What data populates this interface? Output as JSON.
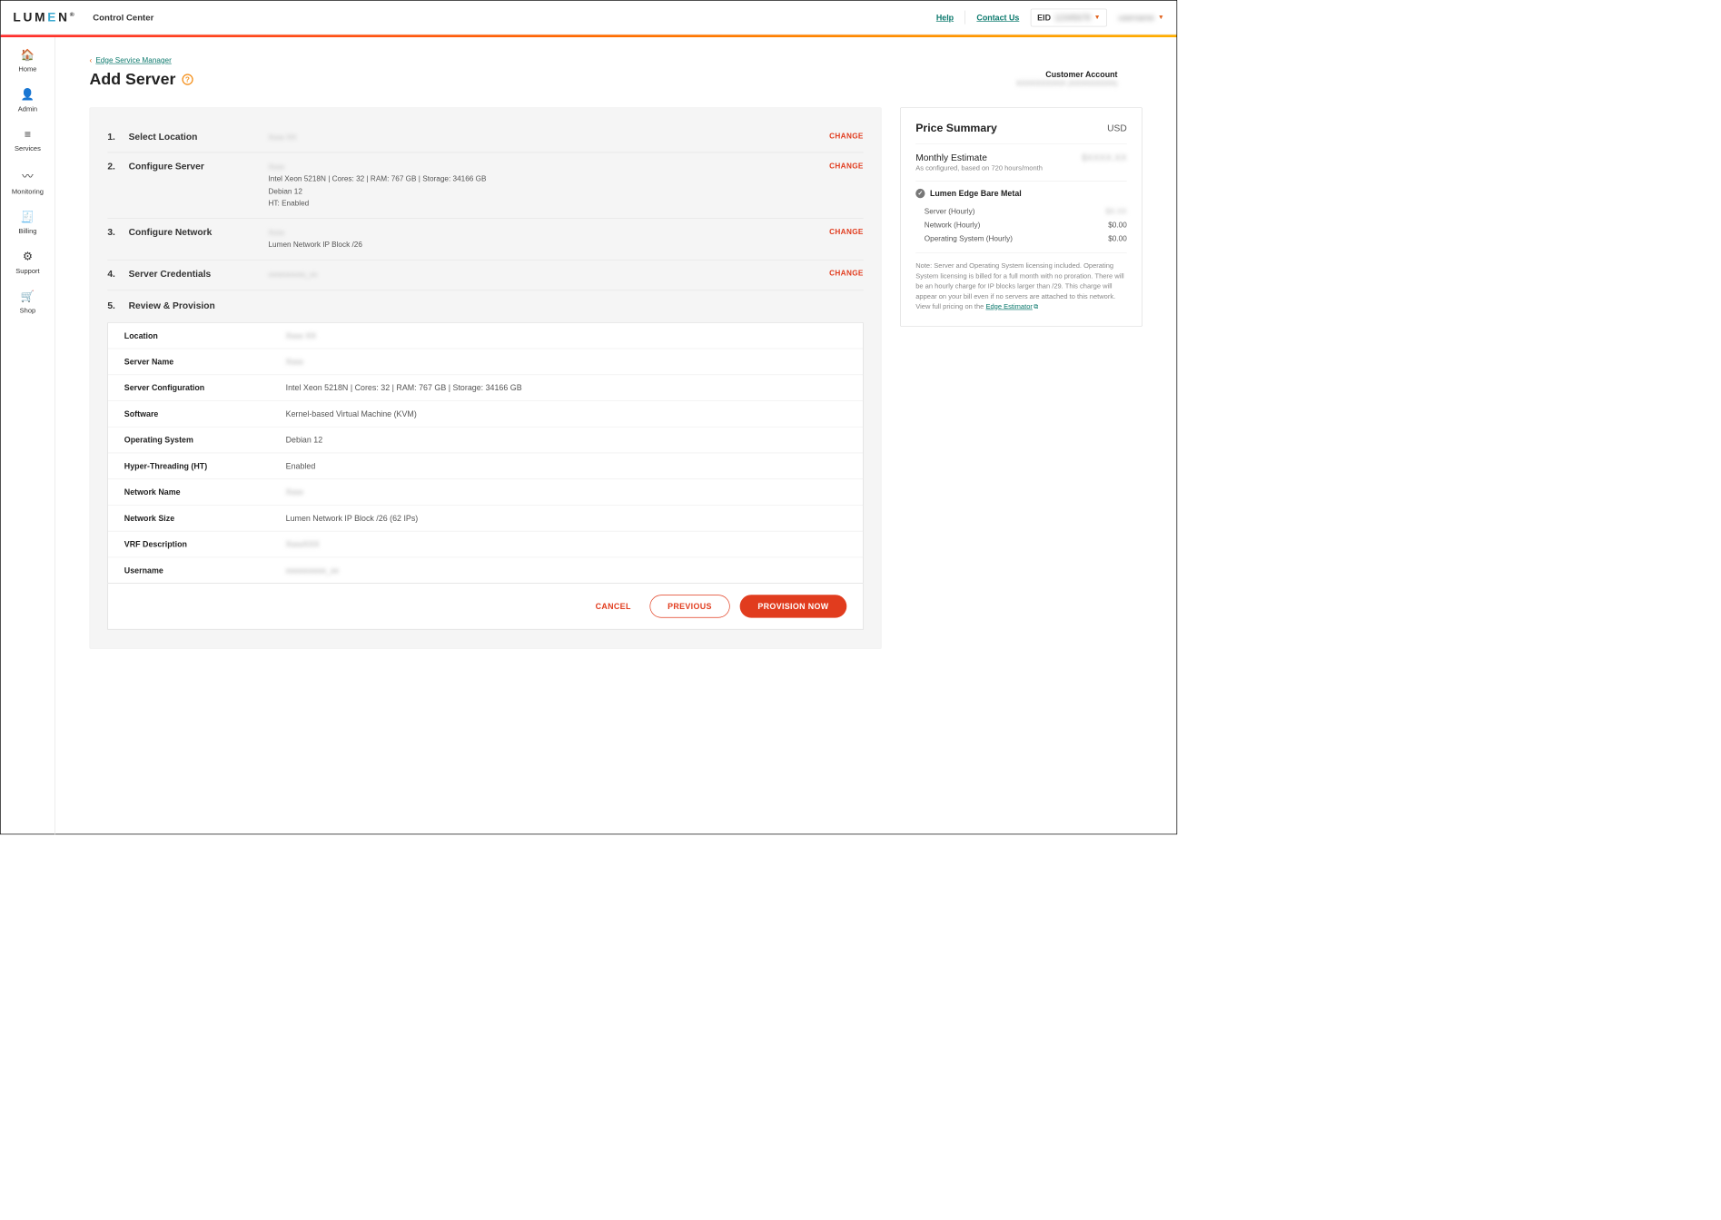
{
  "brand": {
    "name": "LUMEN",
    "product": "Control Center",
    "registeredMark": "®"
  },
  "topnav": {
    "help": "Help",
    "contact": "Contact Us",
    "eidLabel": "EID",
    "eidValue": "12345678",
    "username": "username"
  },
  "sidebar": [
    {
      "icon": "🏠",
      "label": "Home",
      "name": "sidebar-home"
    },
    {
      "icon": "👤",
      "label": "Admin",
      "name": "sidebar-admin"
    },
    {
      "icon": "≡",
      "label": "Services",
      "name": "sidebar-services"
    },
    {
      "icon": "〰",
      "label": "Monitoring",
      "name": "sidebar-monitoring"
    },
    {
      "icon": "🧾",
      "label": "Billing",
      "name": "sidebar-billing"
    },
    {
      "icon": "⚙",
      "label": "Support",
      "name": "sidebar-support"
    },
    {
      "icon": "🛒",
      "label": "Shop",
      "name": "sidebar-shop"
    }
  ],
  "breadcrumb": {
    "label": "Edge Service Manager"
  },
  "page": {
    "title": "Add Server"
  },
  "customerAccount": {
    "label": "Customer Account",
    "value": "XXXXXXXXXX (XXXXXXXXX)"
  },
  "steps": {
    "s1": {
      "num": "1.",
      "title": "Select Location",
      "summary_blurred": "Xxxx XX",
      "change": "CHANGE"
    },
    "s2": {
      "num": "2.",
      "title": "Configure Server",
      "line0_blurred": "Xxxx",
      "line1": "Intel Xeon 5218N | Cores: 32 | RAM: 767 GB | Storage: 34166 GB",
      "line2": "Debian 12",
      "line3": "HT: Enabled",
      "change": "CHANGE"
    },
    "s3": {
      "num": "3.",
      "title": "Configure Network",
      "line0_blurred": "Xxxx",
      "line1": "Lumen Network IP Block /26",
      "change": "CHANGE"
    },
    "s4": {
      "num": "4.",
      "title": "Server Credentials",
      "line0_blurred": "xxxxxxxxxx_xx",
      "change": "CHANGE"
    },
    "s5": {
      "num": "5.",
      "title": "Review & Provision"
    }
  },
  "review": [
    {
      "label": "Location",
      "value": "Xxxx XX",
      "blurred": true
    },
    {
      "label": "Server Name",
      "value": "Xxxx",
      "blurred": true
    },
    {
      "label": "Server Configuration",
      "value": "Intel Xeon 5218N | Cores: 32 | RAM: 767 GB | Storage: 34166 GB",
      "blurred": false
    },
    {
      "label": "Software",
      "value": "Kernel-based Virtual Machine (KVM)",
      "blurred": false
    },
    {
      "label": "Operating System",
      "value": "Debian 12",
      "blurred": false
    },
    {
      "label": "Hyper-Threading (HT)",
      "value": "Enabled",
      "blurred": false
    },
    {
      "label": "Network Name",
      "value": "Xxxx",
      "blurred": true
    },
    {
      "label": "Network Size",
      "value": "Lumen Network IP Block /26 (62 IPs)",
      "blurred": false
    },
    {
      "label": "VRF Description",
      "value": "XxxxXXX",
      "blurred": true
    },
    {
      "label": "Username",
      "value": "xxxxxxxxxx_xx",
      "blurred": true
    }
  ],
  "actions": {
    "cancel": "CANCEL",
    "previous": "PREVIOUS",
    "provision": "PROVISION NOW"
  },
  "price": {
    "title": "Price Summary",
    "currency": "USD",
    "monthlyLabel": "Monthly Estimate",
    "monthlyValue": "$XXXX.XX",
    "monthlySub": "As configured, based on 720 hours/month",
    "sectionTitle": "Lumen Edge Bare Metal",
    "lines": [
      {
        "label": "Server (Hourly)",
        "value": "$X.XX",
        "blurred": true
      },
      {
        "label": "Network (Hourly)",
        "value": "$0.00",
        "blurred": false
      },
      {
        "label": "Operating System (Hourly)",
        "value": "$0.00",
        "blurred": false
      }
    ],
    "note": "Note: Server and Operating System licensing included. Operating System licensing is billed for a full month with no proration. There will be an hourly charge for IP blocks larger than /29. This charge will appear on your bill even if no servers are attached to this network. View full pricing on the ",
    "noteLink": "Edge Estimator"
  }
}
